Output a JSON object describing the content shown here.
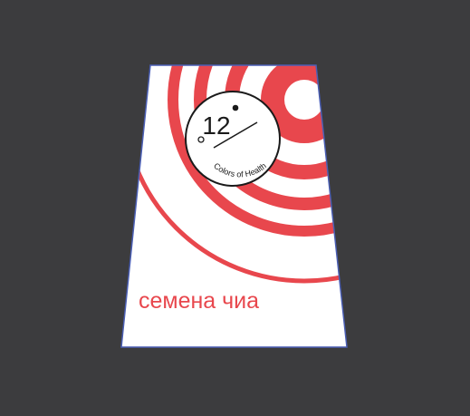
{
  "canvas": {
    "background": "#3c3c3e"
  },
  "package": {
    "product_name": "семена чиа",
    "background_color": "#ffffff",
    "outline_color": "#4b5fb5",
    "accent_color": "#e8474d"
  },
  "logo": {
    "number": "12",
    "tagline": "Colors of Health",
    "ink_color": "#1a1a1a",
    "fill_color": "#ffffff"
  }
}
